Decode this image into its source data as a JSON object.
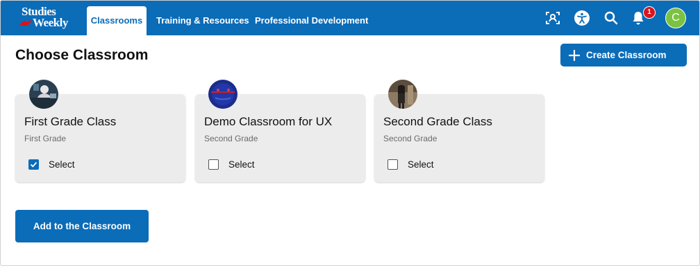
{
  "brand": {
    "logo_line1": "Studies",
    "logo_line2": "Weekly",
    "primary_color": "#0b6cb8"
  },
  "nav": {
    "tabs": [
      {
        "label": "Classrooms",
        "active": true
      },
      {
        "label": "Training & Resources",
        "active": false
      },
      {
        "label": "Professional Development",
        "active": false
      }
    ],
    "icons": [
      "scan-user-icon",
      "accessibility-icon",
      "search-icon",
      "bell-icon"
    ],
    "notification_count": "1",
    "user_initial": "C"
  },
  "page": {
    "title": "Choose Classroom",
    "create_label": "Create Classroom",
    "submit_label": "Add to the Classroom"
  },
  "classrooms": [
    {
      "name": "First Grade Class",
      "grade": "First Grade",
      "select_label": "Select",
      "selected": true
    },
    {
      "name": "Demo Classroom for UX",
      "grade": "Second Grade",
      "select_label": "Select",
      "selected": false
    },
    {
      "name": "Second Grade Class",
      "grade": "Second Grade",
      "select_label": "Select",
      "selected": false
    }
  ]
}
